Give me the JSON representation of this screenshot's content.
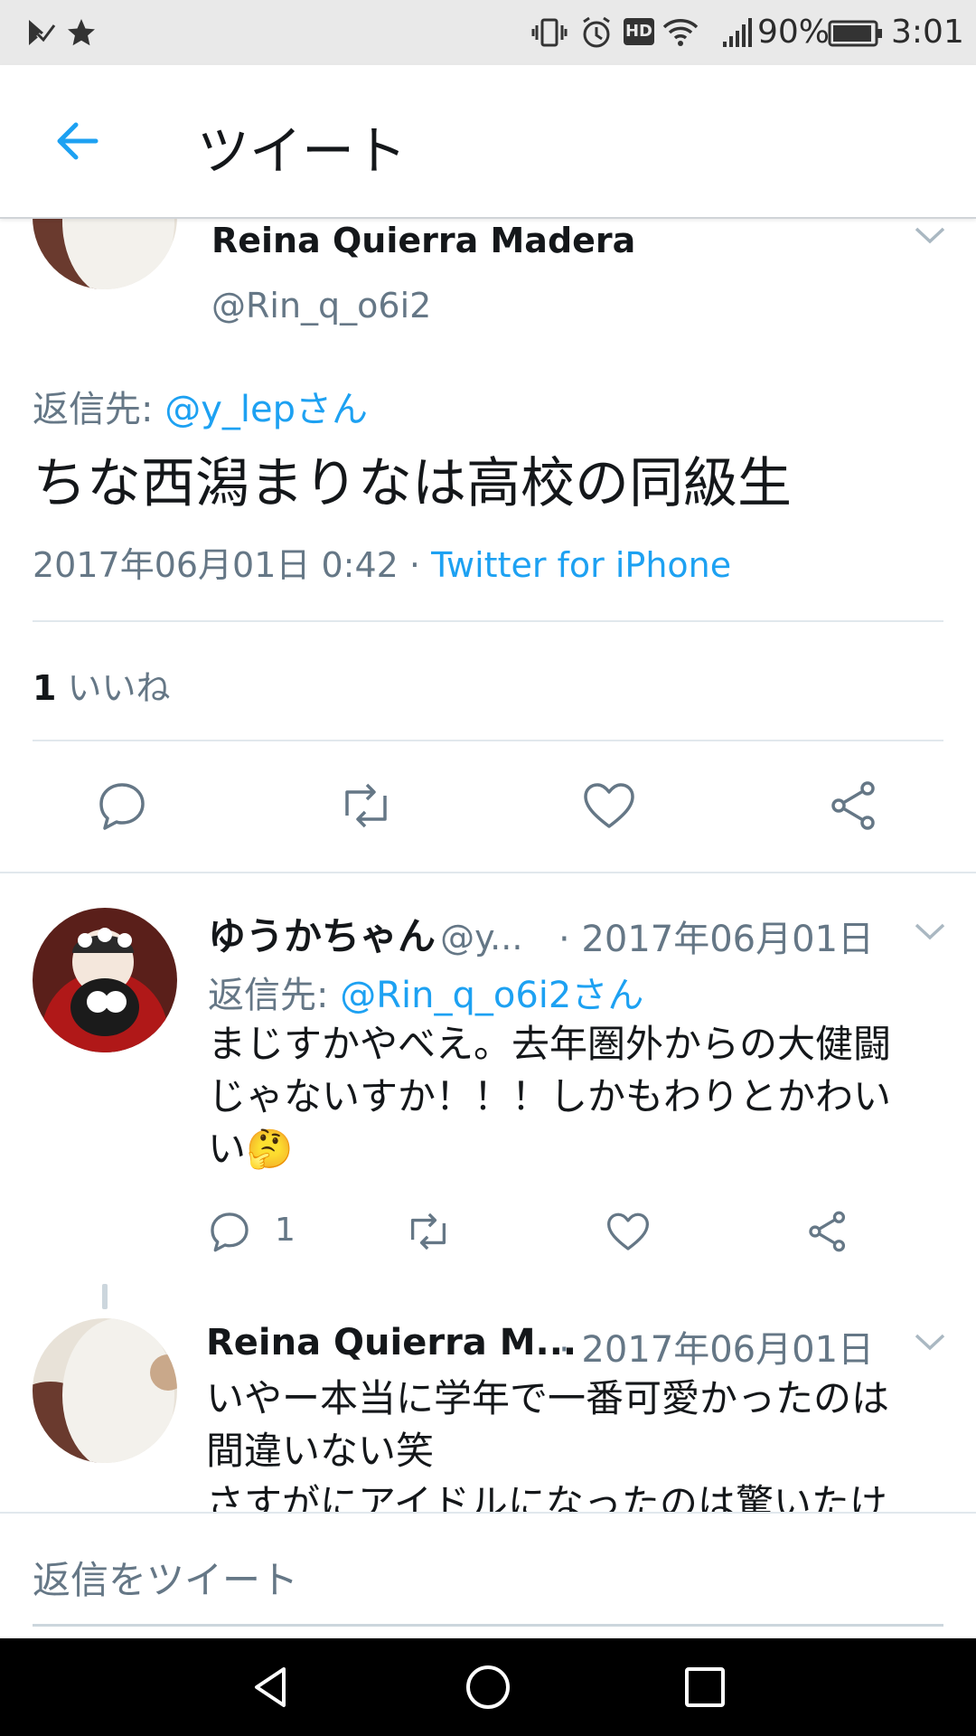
{
  "status_bar": {
    "battery": "90%",
    "time": "3:01",
    "hd": "HD"
  },
  "app_bar": {
    "title": "ツイート"
  },
  "main_tweet": {
    "name": "Reina Quierra Madera",
    "handle": "@Rin_q_o6i2",
    "reply_prefix": "返信先:",
    "reply_to": "@y_lepさん",
    "text": "ちな西潟まりなは高校の同級生",
    "timestamp": "2017年06月01日 0:42",
    "dot": "·",
    "source": "Twitter for iPhone",
    "likes_count": "1",
    "likes_label": "いいね"
  },
  "reply1": {
    "name": "ゆうかちゃん",
    "handle": "@y...",
    "date": "· 2017年06月01日",
    "reply_prefix": "返信先:",
    "reply_to": "@Rin_q_o6i2さん",
    "text_line1": "まじすかやべえ。去年圏外からの大健闘",
    "text_line2": "じゃないすか！！！しかもわりとかわい",
    "text_line3": "い",
    "emoji": "🤔",
    "reply_count": "1"
  },
  "reply2": {
    "name": "Reina Quierra M...",
    "date": "· 2017年06月01日",
    "text_line1": "いやー本当に学年で一番可愛かったのは",
    "text_line2": "間違いない笑",
    "text_line3": "さすがにアイドルになったのは驚いたけ"
  },
  "reply_bar": {
    "placeholder": "返信をツイート"
  },
  "colors": {
    "accent": "#1da1f2",
    "secondary_text": "#657786",
    "icon": "#657786"
  }
}
